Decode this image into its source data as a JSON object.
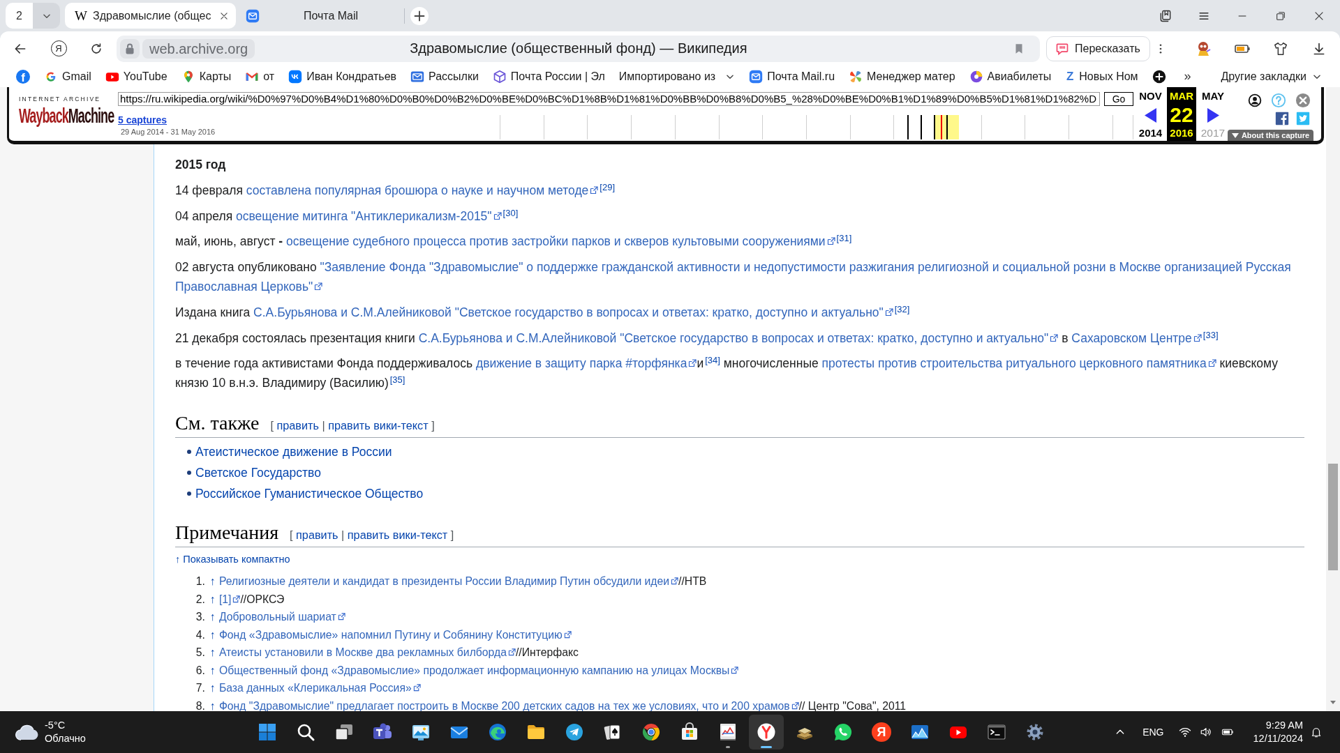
{
  "browser": {
    "tab_count": "2",
    "tabs": [
      {
        "kind": "wiki",
        "favicon": "W",
        "title": "Здравомыслие (общес",
        "selected": true
      },
      {
        "kind": "mail",
        "title": "Почта Mail",
        "selected": false
      }
    ],
    "address": {
      "logo": "Я",
      "domain": "web.archive.org",
      "title": "Здравомыслие (общественный фонд) — Википедия"
    },
    "retell": "Пересказать",
    "bookmarks": [
      {
        "kind": "circleletter",
        "glyph": "f"
      },
      {
        "kind": "g",
        "label": "Gmail"
      },
      {
        "kind": "play",
        "label": "YouTube"
      },
      {
        "kind": "pin",
        "label": "Карты"
      },
      {
        "kind": "m",
        "label": "от"
      },
      {
        "kind": "vk",
        "label": "Иван Кондратьев"
      },
      {
        "kind": "envelope",
        "label": "Рассылки"
      },
      {
        "kind": "cube",
        "label": "Почта России | Эл"
      },
      {
        "kind": "folder",
        "label": "Импортировано из"
      },
      {
        "kind": "mailru",
        "label": "Почта Mail.ru"
      },
      {
        "kind": "pinwheel",
        "label": "Менеджер матер"
      },
      {
        "kind": "ball",
        "label": "Авиабилеты"
      },
      {
        "kind": "letter",
        "glyph": "Z",
        "label": "Новых Ном"
      },
      {
        "kind": "plus"
      }
    ],
    "more": "»",
    "other": "Другие закладки"
  },
  "wayback": {
    "logo_caption": "INTERNET ARCHIVE",
    "logo_words": [
      "Wayback",
      "Machine"
    ],
    "url": "https://ru.wikipedia.org/wiki/%D0%97%D0%B4%D1%80%D0%B0%D0%B2%D0%BE%D0%BC%D1%8B%D1%81%D0%BB%D0%B8%D0%B5_%28%D0%BE%D0%B1%D1%89%D0%B5%D1%81%D1%82%D",
    "go": "Go",
    "captures": "5 captures",
    "range": "29 Aug 2014 - 31 May 2016",
    "months": [
      {
        "month": "NOV",
        "year": "2014",
        "selected": false,
        "year_disabled": false
      },
      {
        "month": "MAR",
        "day": "22",
        "year": "2016",
        "selected": true,
        "year_disabled": false
      },
      {
        "month": "MAY",
        "year": "2017",
        "selected": false,
        "year_disabled": true
      }
    ],
    "about": "About this capture"
  },
  "article": {
    "year_heading": "2015 год",
    "paragraphs": [
      {
        "parts": [
          {
            "kind": "text",
            "text": "14 февраля "
          },
          {
            "kind": "link",
            "text": "составлена популярная брошюра о науке и научном методе",
            "external": true
          },
          {
            "kind": "ref",
            "text": "[29]"
          }
        ]
      },
      {
        "parts": [
          {
            "kind": "text",
            "text": "04 апреля "
          },
          {
            "kind": "link",
            "text": "освещение митинга \"Антиклерикализм-2015\"",
            "external": true
          },
          {
            "kind": "ref",
            "text": "[30]"
          }
        ]
      },
      {
        "parts": [
          {
            "kind": "text",
            "text": "май, июнь, август **-** "
          },
          {
            "kind": "link",
            "text": "освещение судебного процесса против застройки парков и скверов культовыми сооружениями",
            "external": true
          },
          {
            "kind": "ref",
            "text": "[31]"
          }
        ]
      },
      {
        "parts": [
          {
            "kind": "text",
            "text": "02 августа опубликовано "
          },
          {
            "kind": "link",
            "text": "\"Заявление Фонда \"Здравомыслие\" о поддержке гражданской активности и недопустимости разжигания религиозной и социальной розни в Москве организацией Русская",
            "external": false
          },
          {
            "kind": "link",
            "text": "Православная Церковь\"",
            "external": true
          }
        ]
      },
      {
        "parts": [
          {
            "kind": "text",
            "text": "Издана книга "
          },
          {
            "kind": "link",
            "text": "С.А.Бурьянова и С.М.Алейниковой \"Светское государство в вопросах и ответах: кратко, доступно и актуально\"",
            "external": true
          },
          {
            "kind": "ref",
            "text": "[32]"
          }
        ]
      },
      {
        "parts": [
          {
            "kind": "text",
            "text": "21 декабря состоялась презентация книги "
          },
          {
            "kind": "link",
            "text": "С.А.Бурьянова и С.М.Алейниковой \"Светское государство в вопросах и ответах: кратко, доступно и актуально\"",
            "external": true
          },
          {
            "kind": "text",
            "text": " в "
          },
          {
            "kind": "link",
            "text": "Сахаровском Центре",
            "external": true
          },
          {
            "kind": "ref",
            "text": "[33]"
          }
        ]
      },
      {
        "parts": [
          {
            "kind": "text",
            "text": "в течение года активистами Фонда поддерживалось "
          },
          {
            "kind": "link",
            "text": "движение в защиту парка #торфянка",
            "external": true
          },
          {
            "kind": "text",
            "text": "и"
          },
          {
            "kind": "ref",
            "text": "[34]"
          },
          {
            "kind": "text",
            "text": " многочисленные "
          },
          {
            "kind": "link",
            "text": "протесты против строительства ритуального церковного памятника",
            "external": true
          },
          {
            "kind": "text",
            "text": " киевскому князю 10 в.н.э. Владимиру (Василию)"
          },
          {
            "kind": "ref",
            "text": "[35]"
          }
        ]
      }
    ],
    "see_also": {
      "title": "См. также",
      "edit": {
        "open": "[",
        "links": [
          "править",
          "править вики-текст"
        ],
        "separator": "|",
        "close": "]"
      },
      "items": [
        "Атеистическое движение в России",
        "Светское Государство",
        "Российское Гуманистическое Общество"
      ]
    },
    "notes": {
      "title": "Примечания",
      "edit": {
        "open": "[",
        "links": [
          "править",
          "править вики-текст"
        ],
        "separator": "|",
        "close": "]"
      },
      "toggle": "↑ Показывать компактно",
      "items": [
        {
          "number": "1.",
          "backlink": "↑",
          "parts": [
            {
              "kind": "link",
              "text": "Религиозные деятели и кандидат в президенты России Владимир Путин обсудили идеи",
              "external": true
            },
            {
              "kind": "text",
              "text": "//НТВ"
            }
          ]
        },
        {
          "number": "2.",
          "backlink": "↑",
          "parts": [
            {
              "kind": "link",
              "text": "[1]",
              "external": true
            },
            {
              "kind": "text",
              "text": "//ОРКСЭ"
            }
          ]
        },
        {
          "number": "3.",
          "backlink": "↑",
          "parts": [
            {
              "kind": "link",
              "text": "Добровольный шариат",
              "external": true
            }
          ]
        },
        {
          "number": "4.",
          "backlink": "↑",
          "parts": [
            {
              "kind": "link",
              "text": "Фонд «Здравомыслие» напомнил Путину и Собянину Конституцию",
              "external": true
            }
          ]
        },
        {
          "number": "5.",
          "backlink": "↑",
          "parts": [
            {
              "kind": "link",
              "text": "Атеисты установили в Москве два рекламных билборда",
              "external": true
            },
            {
              "kind": "text",
              "text": "//Интерфакс"
            }
          ]
        },
        {
          "number": "6.",
          "backlink": "↑",
          "parts": [
            {
              "kind": "link",
              "text": "Общественный фонд «Здравомыслие» продолжает информационную кампанию на улицах Москвы",
              "external": true
            }
          ]
        },
        {
          "number": "7.",
          "backlink": "↑",
          "parts": [
            {
              "kind": "link",
              "text": "База данных «Клерикальная Россия»",
              "external": true
            }
          ]
        },
        {
          "number": "8.",
          "backlink": "↑",
          "parts": [
            {
              "kind": "link",
              "text": "Фонд \"Здравомыслие\" предлагает построить в Москве 200 детских садов на тех же условиях, что и 200 храмов",
              "external": true
            },
            {
              "kind": "text",
              "text": " // Центр \"Сова\", 2011"
            }
          ]
        }
      ]
    }
  },
  "taskbar": {
    "weather": {
      "temperature": "-5°C",
      "condition": "Облачно"
    },
    "apps": [
      {
        "kind": "start",
        "running": false,
        "active": false
      },
      {
        "kind": "search",
        "running": false,
        "active": false
      },
      {
        "kind": "taskview",
        "running": false,
        "active": false
      },
      {
        "kind": "people",
        "running": false,
        "active": false
      },
      {
        "kind": "picture",
        "running": false,
        "active": false
      },
      {
        "kind": "mail",
        "running": false,
        "active": false
      },
      {
        "kind": "swirl",
        "running": false,
        "active": false
      },
      {
        "kind": "folder",
        "running": false,
        "active": false
      },
      {
        "kind": "plane",
        "running": false,
        "active": false
      },
      {
        "kind": "cards",
        "running": false,
        "active": false
      },
      {
        "kind": "segments",
        "running": false,
        "active": false
      },
      {
        "kind": "bag",
        "running": false,
        "active": false
      },
      {
        "kind": "chart",
        "running": true,
        "active": false
      },
      {
        "kind": "fork",
        "running": true,
        "active": true
      },
      {
        "kind": "books",
        "running": false,
        "active": false
      },
      {
        "kind": "phone",
        "running": false,
        "active": false
      },
      {
        "kind": "letter",
        "glyph": "Я",
        "running": false,
        "active": false
      },
      {
        "kind": "mountains",
        "running": false,
        "active": false
      },
      {
        "kind": "play",
        "running": false,
        "active": false
      },
      {
        "kind": "terminal",
        "running": false,
        "active": false
      },
      {
        "kind": "gear",
        "running": false,
        "active": false
      }
    ],
    "language": "ENG",
    "time": "9:29 AM",
    "date": "12/11/2024"
  }
}
